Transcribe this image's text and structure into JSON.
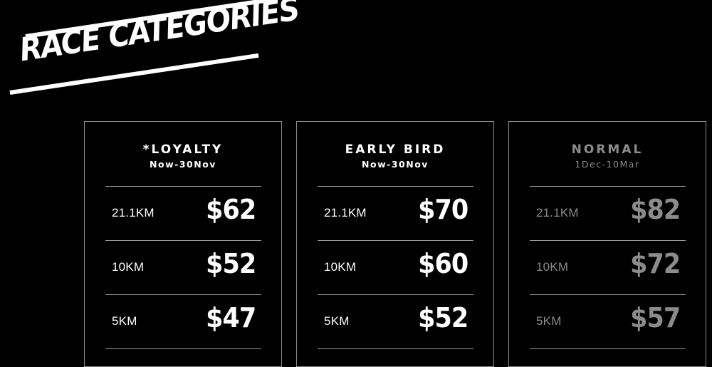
{
  "heading": {
    "title": "RACE CATEGORIES"
  },
  "cards": [
    {
      "name": "*LOYALTY",
      "period": "Now-30Nov",
      "rows": [
        {
          "distance": "21.1KM",
          "price": "$62"
        },
        {
          "distance": "10KM",
          "price": "$52"
        },
        {
          "distance": "5KM",
          "price": "$47"
        }
      ]
    },
    {
      "name": "EARLY BIRD",
      "period": "Now-30Nov",
      "rows": [
        {
          "distance": "21.1KM",
          "price": "$70"
        },
        {
          "distance": "10KM",
          "price": "$60"
        },
        {
          "distance": "5KM",
          "price": "$52"
        }
      ]
    },
    {
      "name": "NORMAL",
      "period": "1Dec-10Mar",
      "rows": [
        {
          "distance": "21.1KM",
          "price": "$82"
        },
        {
          "distance": "10KM",
          "price": "$72"
        },
        {
          "distance": "5KM",
          "price": "$57"
        }
      ]
    }
  ],
  "colors": {
    "background": "#000000",
    "text": "#ffffff",
    "muted": "#8c8c8c",
    "border": "#8a8a8a"
  }
}
